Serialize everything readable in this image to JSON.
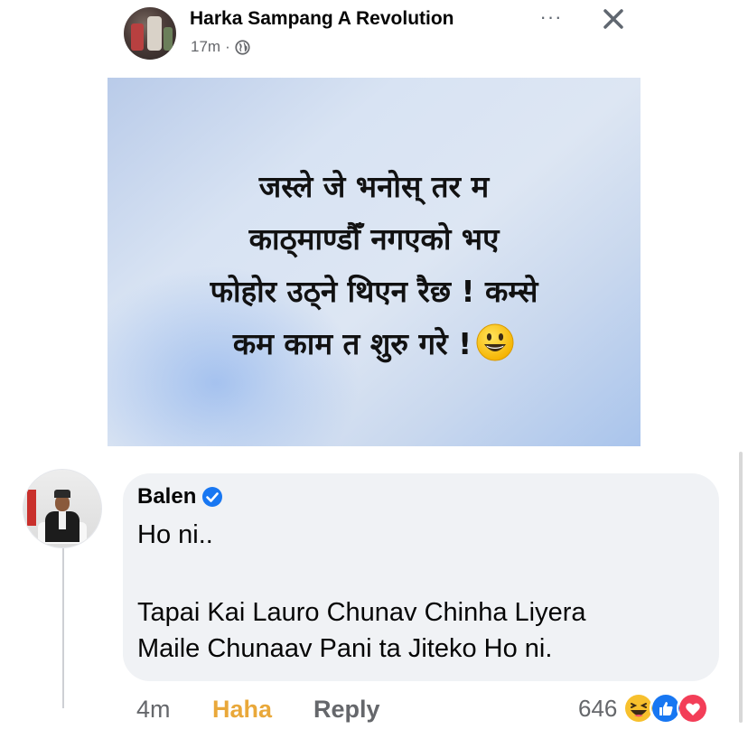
{
  "post": {
    "author": "Harka Sampang A Revolution",
    "time": "17m",
    "separator": "·",
    "more_label": "···",
    "image_text_lines": [
      "जस्ले जे भनोस् तर म",
      "काठ्माण्डौँ नगएको भए",
      "फोहोर उठ्ने थिएन रैछ ! कम्से",
      "कम काम त शुरु गरे !"
    ]
  },
  "comment": {
    "author": "Balen",
    "text_line1": "Ho ni..",
    "text_line2": "Tapai Kai Lauro Chunav Chinha Liyera",
    "text_line3": "Maile Chunaav Pani ta Jiteko Ho ni.",
    "time": "4m",
    "reaction_label": "Haha",
    "reply_label": "Reply",
    "reaction_count": "646"
  },
  "colors": {
    "verified": "#1877f2",
    "haha": "#e9a83a",
    "like": "#1877f2",
    "love": "#f33e58",
    "bubble": "#f0f2f5"
  },
  "icons": [
    "globe-icon",
    "more-icon",
    "close-icon",
    "verified-icon",
    "smiley-emoji-icon",
    "haha-reaction-icon",
    "like-reaction-icon",
    "love-reaction-icon"
  ]
}
